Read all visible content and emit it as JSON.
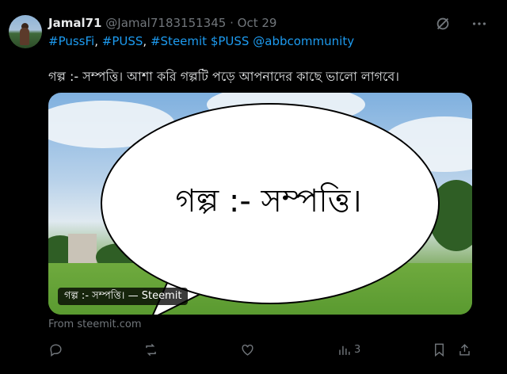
{
  "tweet": {
    "author_name": "Jamal71",
    "handle": "@Jamal7183151345",
    "separator": "·",
    "date": "Oct 29",
    "hashtags": [
      "#PussFi",
      "#PUSS",
      "#Steemit"
    ],
    "tag_separator": ",",
    "cashtag": "$PUSS",
    "mention": "@abbcommunity",
    "text": "গল্প :- সম্পত্তি। আশা করি গল্পটি পড়ে আপনাদের কাছে ভালো লাগবে।"
  },
  "card": {
    "bubble_text": "গল্প :- সম্পত্তি।",
    "label": "গল্প :- সম্পত্তি। — Steemit",
    "source": "From steemit.com"
  },
  "actions": {
    "views_count": "3"
  },
  "icons": [
    "avatar",
    "grok-icon",
    "more-icon",
    "reply-icon",
    "repost-icon",
    "like-icon",
    "views-icon",
    "bookmark-icon",
    "share-icon"
  ],
  "colors": {
    "background": "#000000",
    "text": "#e7e9ea",
    "muted": "#71767b",
    "link": "#1d9bf0"
  }
}
